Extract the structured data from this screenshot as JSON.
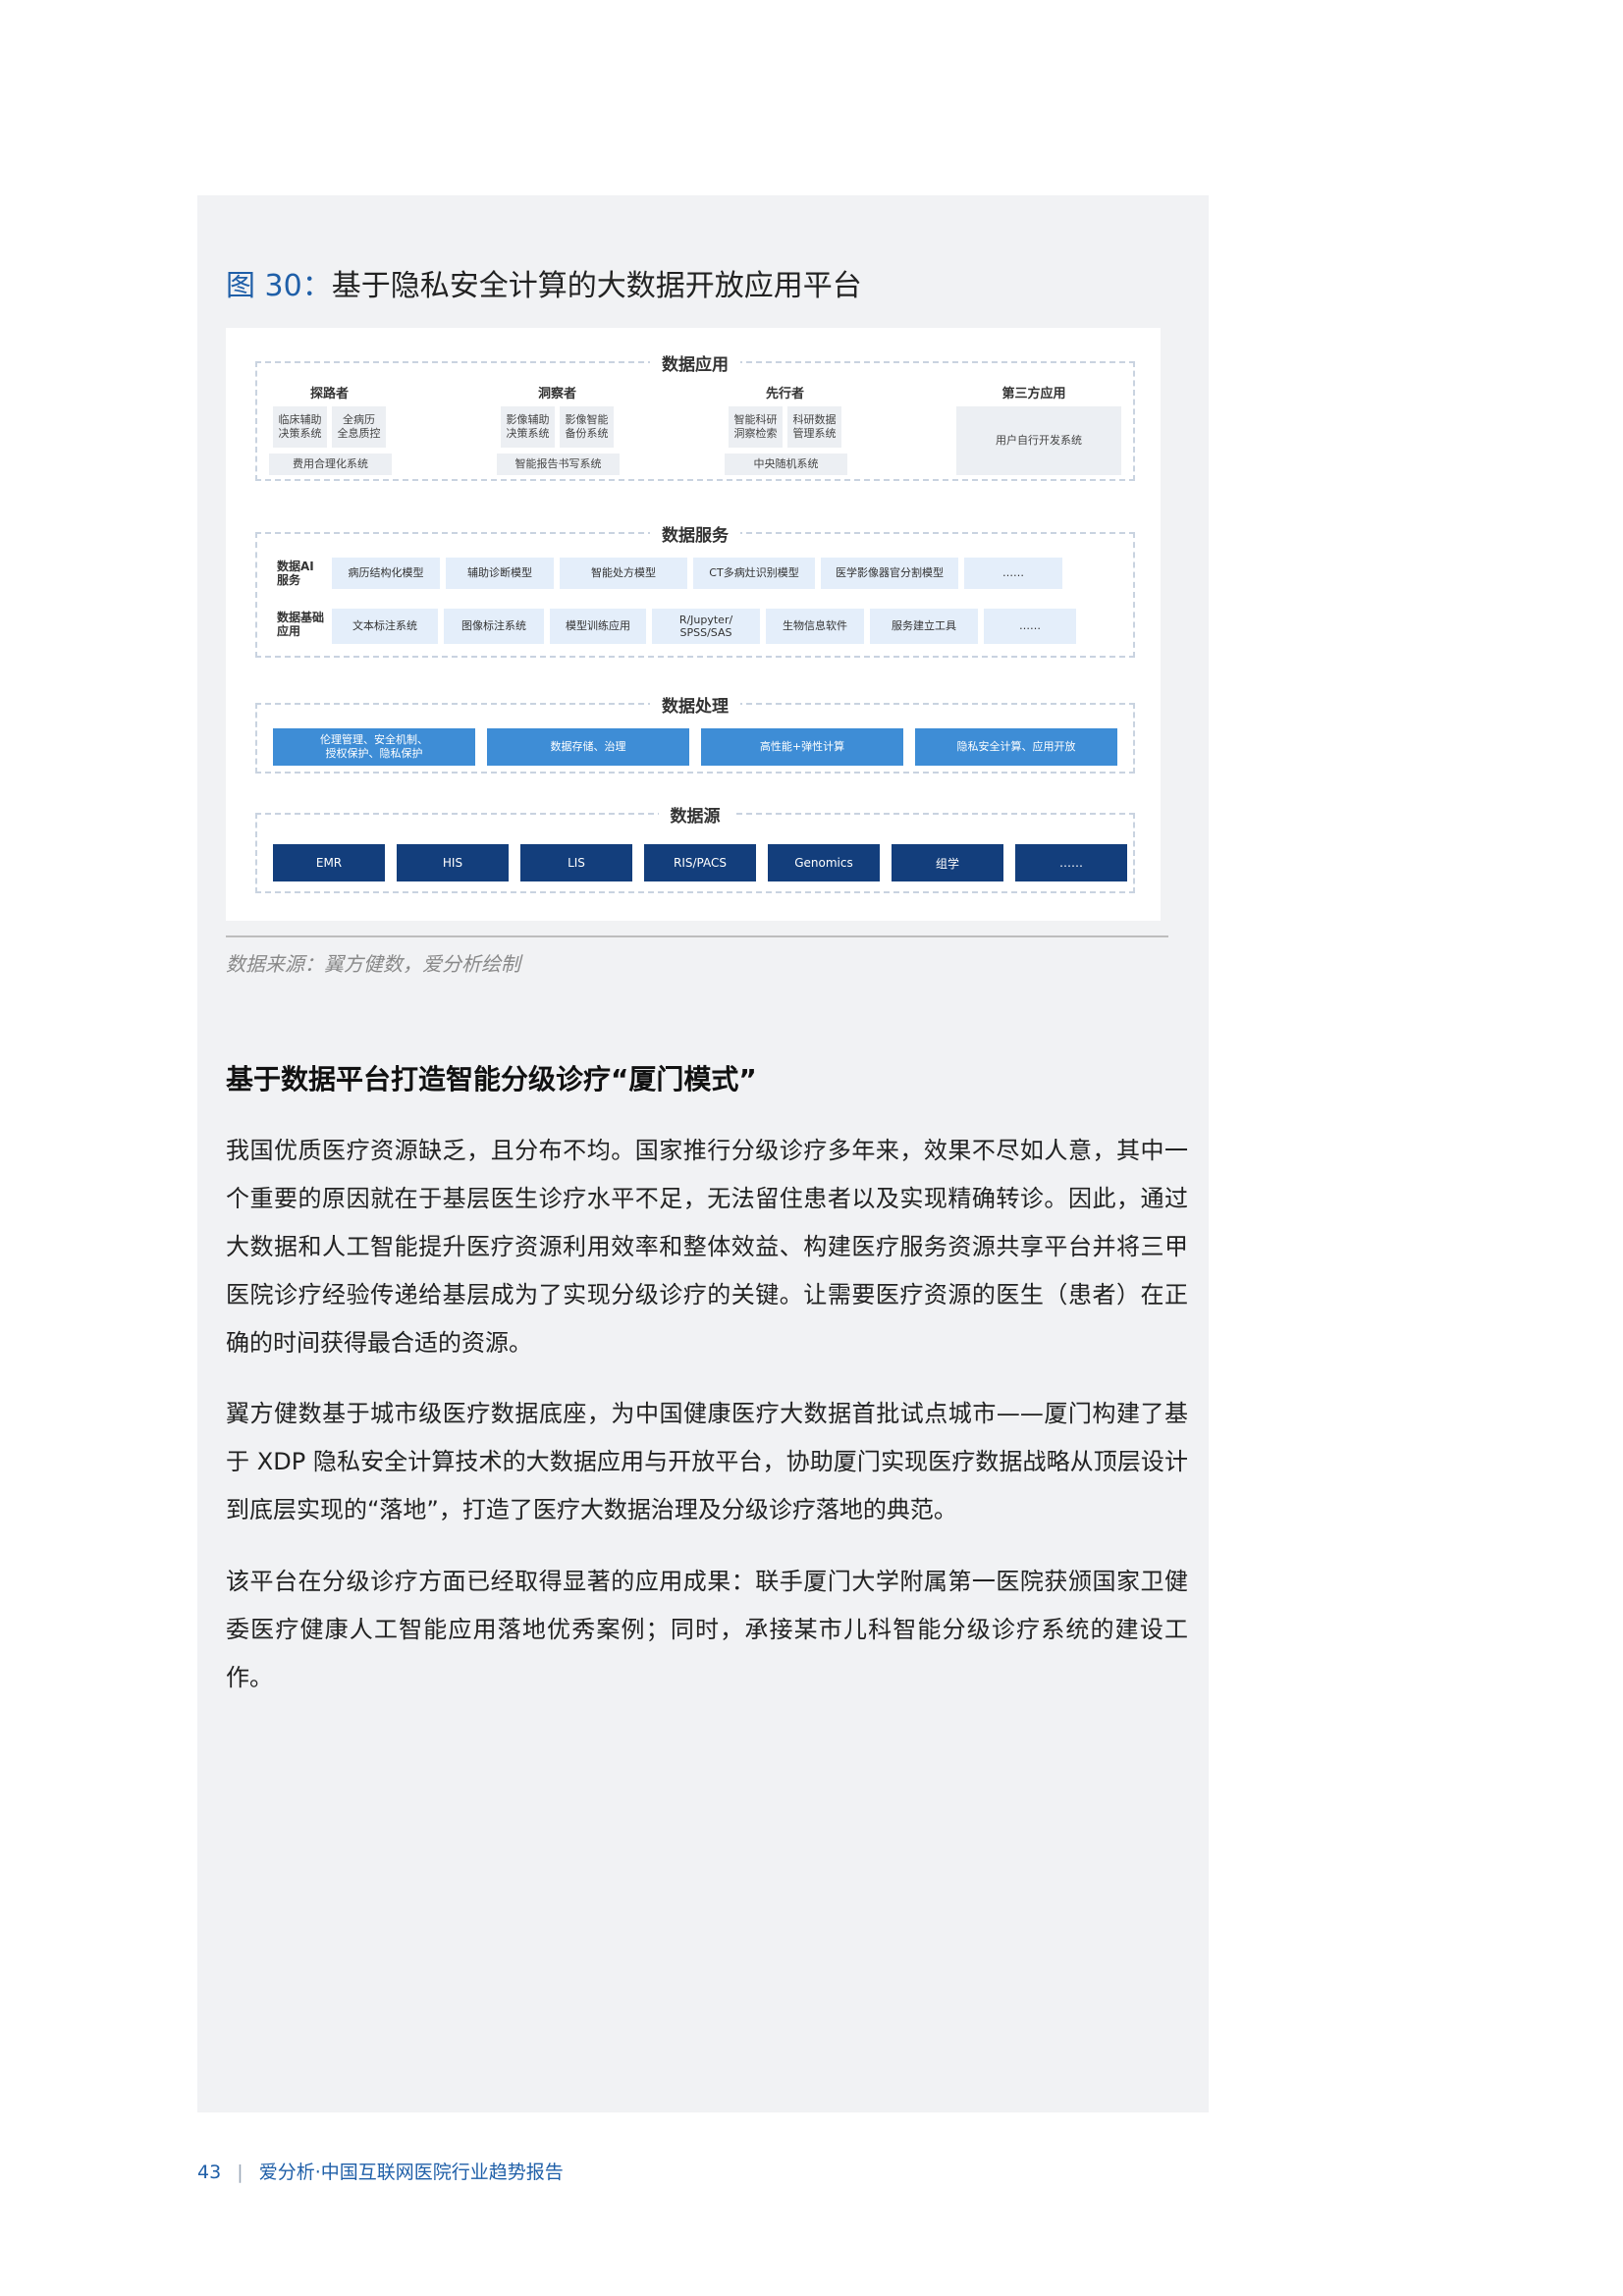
{
  "figure": {
    "number": "图 30：",
    "title": "基于隐私安全计算的大数据开放应用平台",
    "source": "数据来源：翼方健数，爱分析绘制"
  },
  "diagram": {
    "app_layer": {
      "title": "数据应用",
      "groups": [
        {
          "name": "探路者",
          "items": [
            "临床辅助\n决策系统",
            "全病历\n全息质控"
          ],
          "wide": "费用合理化系统"
        },
        {
          "name": "洞察者",
          "items": [
            "影像辅助\n决策系统",
            "影像智能\n备份系统"
          ],
          "wide": "智能报告书写系统"
        },
        {
          "name": "先行者",
          "items": [
            "智能科研\n洞察检索",
            "科研数据\n管理系统"
          ],
          "wide": "中央随机系统"
        },
        {
          "name": "第三方应用",
          "single": "用户自行开发系统"
        }
      ]
    },
    "service_layer": {
      "title": "数据服务",
      "row1_label": "数据AI\n服务",
      "row1": [
        "病历结构化模型",
        "辅助诊断模型",
        "智能处方模型",
        "CT多病灶识别模型",
        "医学影像器官分割模型",
        "……"
      ],
      "row2_label": "数据基础\n应用",
      "row2": [
        "文本标注系统",
        "图像标注系统",
        "模型训练应用",
        "R/Jupyter/\nSPSS/SAS",
        "生物信息软件",
        "服务建立工具",
        "……"
      ]
    },
    "processing_layer": {
      "title": "数据处理",
      "items": [
        "伦理管理、安全机制、\n授权保护、隐私保护",
        "数据存储、治理",
        "高性能+弹性计算",
        "隐私安全计算、应用开放"
      ]
    },
    "source_layer": {
      "title": "数据源",
      "items": [
        "EMR",
        "HIS",
        "LIS",
        "RIS/PACS",
        "Genomics",
        "组学",
        "……"
      ]
    }
  },
  "section": {
    "heading": "基于数据平台打造智能分级诊疗“厦门模式”",
    "paragraphs": [
      "我国优质医疗资源缺乏，且分布不均。国家推行分级诊疗多年来，效果不尽如人意，其中一个重要的原因就在于基层医生诊疗水平不足，无法留住患者以及实现精确转诊。因此，通过大数据和人工智能提升医疗资源利用效率和整体效益、构建医疗服务资源共享平台并将三甲医院诊疗经验传递给基层成为了实现分级诊疗的关键。让需要医疗资源的医生（患者）在正确的时间获得最合适的资源。",
      "翼方健数基于城市级医疗数据底座，为中国健康医疗大数据首批试点城市——厦门构建了基于 XDP 隐私安全计算技术的大数据应用与开放平台，协助厦门实现医疗数据战略从顶层设计到底层实现的“落地”，打造了医疗大数据治理及分级诊疗落地的典范。",
      "该平台在分级诊疗方面已经取得显著的应用成果：联手厦门大学附属第一医院获颁国家卫健委医疗健康人工智能应用落地优秀案例；同时，承接某市儿科智能分级诊疗系统的建设工作。"
    ]
  },
  "footer": {
    "page": "43",
    "separator": "|",
    "text": "爱分析·中国互联网医院行业趋势报告"
  }
}
